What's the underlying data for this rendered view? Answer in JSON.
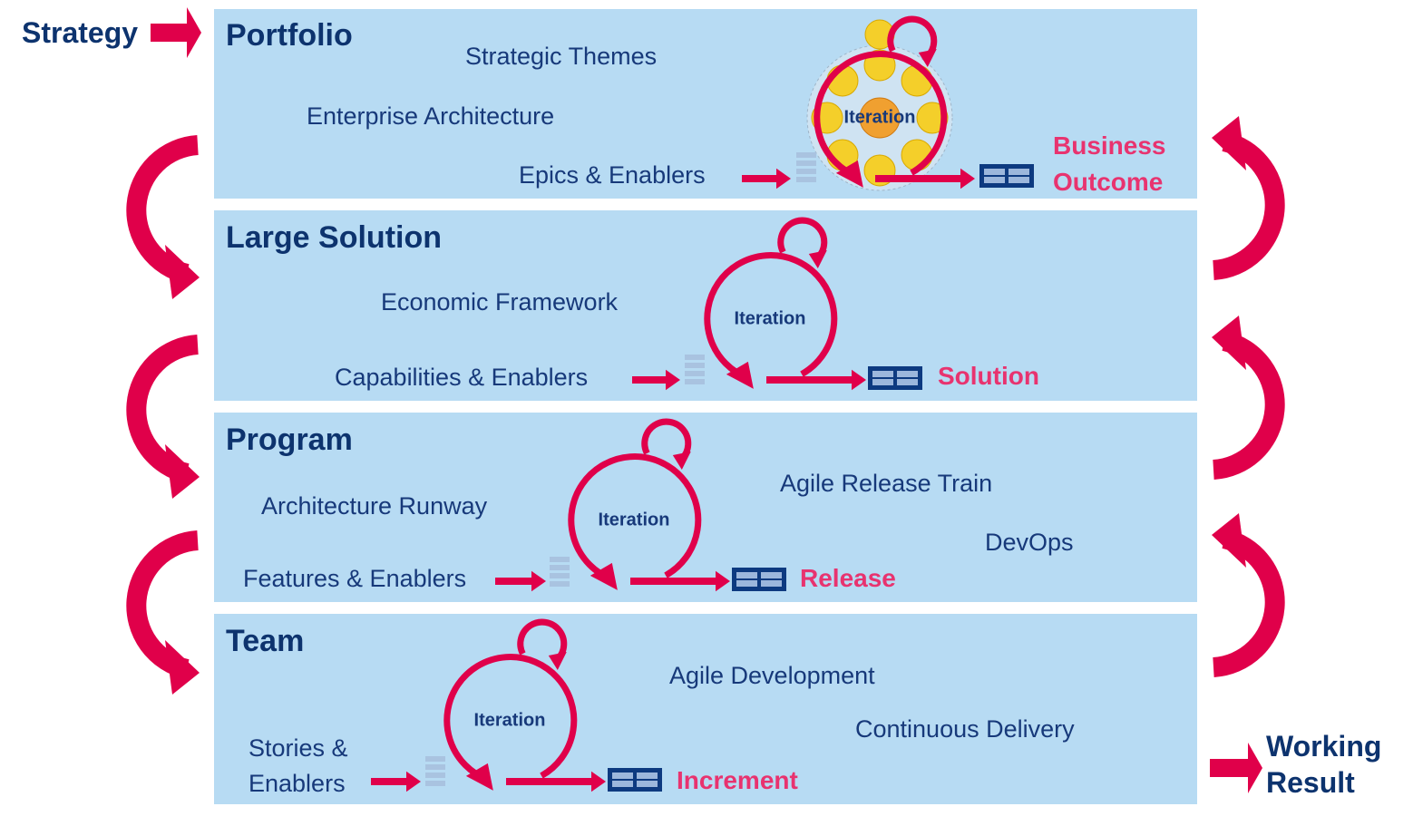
{
  "colors": {
    "panel": "#b7dbf3",
    "arrow": "#e0004a",
    "navy": "#0d336e",
    "outcome": "#e8336f"
  },
  "side": {
    "strategy": "Strategy",
    "working_result": "Working\nResult"
  },
  "iteration_label": "Iteration",
  "layers": [
    {
      "title": "Portfolio",
      "items": [
        "Strategic Themes",
        "Enterprise Architecture",
        "Epics & Enablers"
      ],
      "outcome": "Business\nOutcome"
    },
    {
      "title": "Large Solution",
      "items": [
        "Economic Framework",
        "Capabilities & Enablers"
      ],
      "outcome": "Solution"
    },
    {
      "title": "Program",
      "items": [
        "Architecture Runway",
        "Features & Enablers",
        "Agile Release Train",
        "DevOps"
      ],
      "outcome": "Release"
    },
    {
      "title": "Team",
      "items": [
        "Stories &\nEnablers",
        "Agile Development",
        "Continuous Delivery"
      ],
      "outcome": "Increment"
    }
  ]
}
